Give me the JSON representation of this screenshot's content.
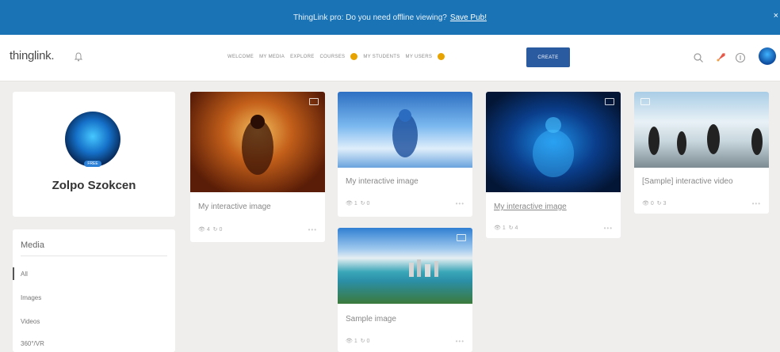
{
  "banner": {
    "text": "ThingLink pro: Do you need offline viewing?",
    "link": "Save Pub!",
    "close": "×"
  },
  "header": {
    "logo": "thinglink.",
    "nav": [
      "WELCOME",
      "MY MEDIA",
      "EXPLORE",
      "COURSES",
      "MY STUDENTS",
      "MY USERS"
    ],
    "create": "CREATE"
  },
  "profile": {
    "name": "Zolpo Szokcen",
    "badge": "FREE"
  },
  "sidebar": {
    "title": "Media",
    "items": [
      "All",
      "Images",
      "Videos",
      "360°/VR"
    ]
  },
  "cards": [
    {
      "title": "My interactive image",
      "views": "4",
      "reactions": "0",
      "more": "•••"
    },
    {
      "title": "My interactive image",
      "views": "1",
      "reactions": "0",
      "more": "•••"
    },
    {
      "title": "My interactive image",
      "views": "1",
      "reactions": "4",
      "more": "•••"
    },
    {
      "title": "[Sample] interactive video",
      "views": "0",
      "reactions": "3",
      "more": "•••"
    },
    {
      "title": "Sample image",
      "views": "1",
      "reactions": "0",
      "more": "•••"
    }
  ],
  "colors": {
    "banner": "#1a73b5",
    "create": "#2a5aa0",
    "badge": "#e7a400"
  }
}
